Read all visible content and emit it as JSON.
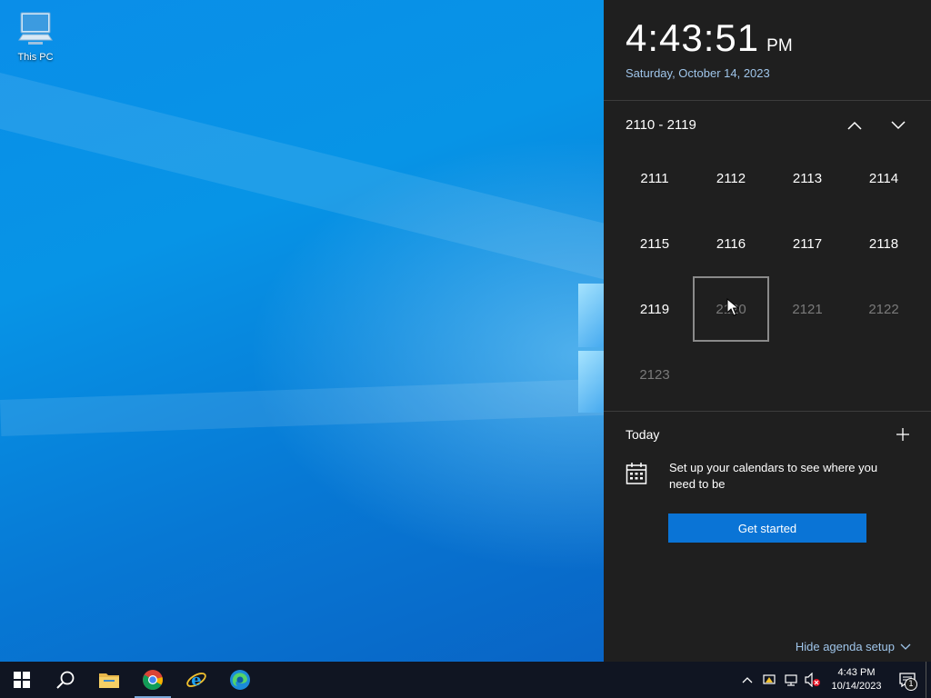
{
  "desktop": {
    "icons": [
      {
        "label": "This PC",
        "icon": "computer-icon"
      }
    ]
  },
  "flyout": {
    "time": "4:43:51",
    "ampm": "PM",
    "date": "Saturday, October 14, 2023",
    "decade_range": "2110 - 2119",
    "years": [
      {
        "label": "2111",
        "dim": false
      },
      {
        "label": "2112",
        "dim": false
      },
      {
        "label": "2113",
        "dim": false
      },
      {
        "label": "2114",
        "dim": false
      },
      {
        "label": "2115",
        "dim": false
      },
      {
        "label": "2116",
        "dim": false
      },
      {
        "label": "2117",
        "dim": false
      },
      {
        "label": "2118",
        "dim": false
      },
      {
        "label": "2119",
        "dim": false
      },
      {
        "label": "2120",
        "dim": true,
        "hover": true
      },
      {
        "label": "2121",
        "dim": true
      },
      {
        "label": "2122",
        "dim": true
      },
      {
        "label": "2123",
        "dim": true
      }
    ],
    "agenda": {
      "today_label": "Today",
      "setup_text": "Set up your calendars to see where you need to be",
      "get_started_label": "Get started",
      "hide_label": "Hide agenda setup"
    }
  },
  "taskbar": {
    "pinned": [
      {
        "name": "start",
        "icon": "windows-logo-icon"
      },
      {
        "name": "search",
        "icon": "search-icon"
      },
      {
        "name": "file-explorer",
        "icon": "folder-icon"
      },
      {
        "name": "chrome",
        "icon": "chrome-icon"
      },
      {
        "name": "internet-explorer",
        "icon": "ie-icon"
      },
      {
        "name": "edge",
        "icon": "edge-icon"
      }
    ],
    "clock": {
      "time": "4:43 PM",
      "date": "10/14/2023"
    },
    "notification_count": "1"
  },
  "colors": {
    "accent": "#0a74d6",
    "flyout_bg": "#1f1f1f",
    "taskbar_bg": "#101522",
    "date_text": "#9fc5ea"
  }
}
